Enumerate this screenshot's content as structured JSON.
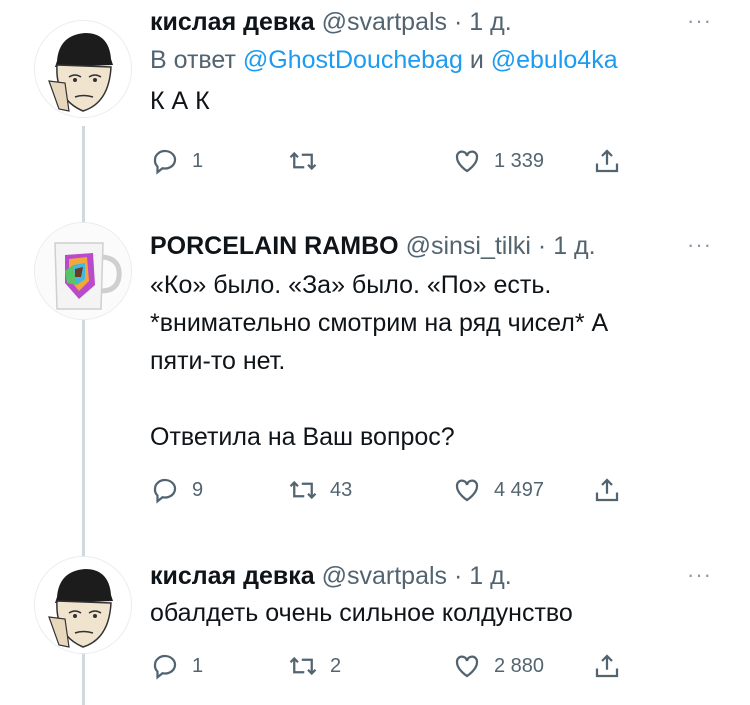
{
  "tweets": [
    {
      "name": "кислая девка",
      "handle": "@svartpals",
      "dot": "·",
      "time": "1 д.",
      "more": "···",
      "reply_prefix": "В ответ",
      "reply_to_1": "@GhostDouchebag",
      "reply_and": "и",
      "reply_to_2": "@ebulo4ka",
      "text": "К А К",
      "replies": "1",
      "retweets": "",
      "likes": "1 339"
    },
    {
      "name": "PORCELAIN RAMBO",
      "handle": "@sinsi_tilki",
      "dot": "·",
      "time": "1 д.",
      "more": "···",
      "text": "«Ко» было. «За» было. «По» есть.\n*внимательно смотрим на ряд чисел* А\nпяти-то нет.\n\nОтветила на Ваш вопрос?",
      "replies": "9",
      "retweets": "43",
      "likes": "4 497"
    },
    {
      "name": "кислая девка",
      "handle": "@svartpals",
      "dot": "·",
      "time": "1 д.",
      "more": "···",
      "text": "обалдеть очень сильное колдунство",
      "replies": "1",
      "retweets": "2",
      "likes": "2 880"
    }
  ],
  "icons": {
    "reply": "reply-icon",
    "retweet": "retweet-icon",
    "like": "heart-icon",
    "share": "share-icon"
  },
  "colors": {
    "link": "#1d9bf0",
    "secondary": "#536471",
    "thread_line": "#cfd9de"
  }
}
